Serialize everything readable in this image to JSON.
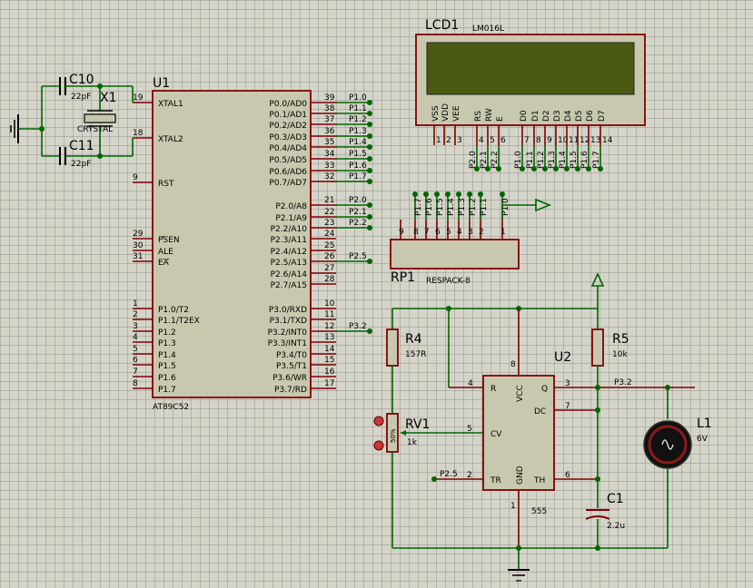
{
  "schematic": {
    "u1": {
      "ref": "U1",
      "part": "AT89C52",
      "left_pins": [
        {
          "num": "19",
          "name": "XTAL1"
        },
        {
          "num": "18",
          "name": "XTAL2"
        },
        {
          "num": "9",
          "name": "RST"
        },
        {
          "num": "29",
          "name": "PSEN"
        },
        {
          "num": "30",
          "name": "ALE"
        },
        {
          "num": "31",
          "name": "EA"
        },
        {
          "num": "1",
          "name": "P1.0/T2"
        },
        {
          "num": "2",
          "name": "P1.1/T2EX"
        },
        {
          "num": "3",
          "name": "P1.2"
        },
        {
          "num": "4",
          "name": "P1.3"
        },
        {
          "num": "5",
          "name": "P1.4"
        },
        {
          "num": "6",
          "name": "P1.5"
        },
        {
          "num": "7",
          "name": "P1.6"
        },
        {
          "num": "8",
          "name": "P1.7"
        }
      ],
      "right_pins": [
        {
          "num": "39",
          "name": "P0.0/AD0",
          "net": "P1.0"
        },
        {
          "num": "38",
          "name": "P0.1/AD1",
          "net": "P1.1"
        },
        {
          "num": "37",
          "name": "P0.2/AD2",
          "net": "P1.2"
        },
        {
          "num": "36",
          "name": "P0.3/AD3",
          "net": "P1.3"
        },
        {
          "num": "35",
          "name": "P0.4/AD4",
          "net": "P1.4"
        },
        {
          "num": "34",
          "name": "P0.5/AD5",
          "net": "P1.5"
        },
        {
          "num": "33",
          "name": "P0.6/AD6",
          "net": "P1.6"
        },
        {
          "num": "32",
          "name": "P0.7/AD7",
          "net": "P1.7"
        },
        {
          "num": "21",
          "name": "P2.0/A8",
          "net": "P2.0"
        },
        {
          "num": "22",
          "name": "P2.1/A9",
          "net": "P2.1"
        },
        {
          "num": "23",
          "name": "P2.2/A10",
          "net": "P2.2"
        },
        {
          "num": "24",
          "name": "P2.3/A11",
          "net": ""
        },
        {
          "num": "25",
          "name": "P2.4/A12",
          "net": ""
        },
        {
          "num": "26",
          "name": "P2.5/A13",
          "net": "P2.5"
        },
        {
          "num": "27",
          "name": "P2.6/A14",
          "net": ""
        },
        {
          "num": "28",
          "name": "P2.7/A15",
          "net": ""
        },
        {
          "num": "10",
          "name": "P3.0/RXD",
          "net": ""
        },
        {
          "num": "11",
          "name": "P3.1/TXD",
          "net": ""
        },
        {
          "num": "12",
          "name": "P3.2/INT0",
          "net": "P3.2"
        },
        {
          "num": "13",
          "name": "P3.3/INT1",
          "net": ""
        },
        {
          "num": "14",
          "name": "P3.4/T0",
          "net": ""
        },
        {
          "num": "15",
          "name": "P3.5/T1",
          "net": ""
        },
        {
          "num": "16",
          "name": "P3.6/WR",
          "net": ""
        },
        {
          "num": "17",
          "name": "P3.7/RD",
          "net": ""
        }
      ]
    },
    "lcd": {
      "ref": "LCD1",
      "part": "LM016L",
      "pins": [
        {
          "name": "VSS",
          "num": "1",
          "net": ""
        },
        {
          "name": "VDD",
          "num": "2",
          "net": ""
        },
        {
          "name": "VEE",
          "num": "3",
          "net": ""
        },
        {
          "name": "RS",
          "num": "4",
          "net": "P2.0"
        },
        {
          "name": "RW",
          "num": "5",
          "net": "P2.1"
        },
        {
          "name": "E",
          "num": "6",
          "net": "P2.2"
        },
        {
          "name": "D0",
          "num": "7",
          "net": "P1.0"
        },
        {
          "name": "D1",
          "num": "8",
          "net": "P1.1"
        },
        {
          "name": "D2",
          "num": "9",
          "net": "P1.2"
        },
        {
          "name": "D3",
          "num": "10",
          "net": "P1.3"
        },
        {
          "name": "D4",
          "num": "11",
          "net": "P1.4"
        },
        {
          "name": "D5",
          "num": "12",
          "net": "P1.5"
        },
        {
          "name": "D6",
          "num": "13",
          "net": "P1.6"
        },
        {
          "name": "D7",
          "num": "14",
          "net": "P1.7"
        }
      ]
    },
    "rp1": {
      "ref": "RP1",
      "part": "RESPACK-8",
      "pins": [
        {
          "num": "9",
          "net": ""
        },
        {
          "num": "8",
          "net": "P1.7"
        },
        {
          "num": "7",
          "net": "P1.6"
        },
        {
          "num": "6",
          "net": "P1.5"
        },
        {
          "num": "5",
          "net": "P1.4"
        },
        {
          "num": "4",
          "net": "P1.3"
        },
        {
          "num": "3",
          "net": "P1.2"
        },
        {
          "num": "2",
          "net": "P1.1"
        },
        {
          "num": "1",
          "net": "P1.0"
        }
      ]
    },
    "c10": {
      "ref": "C10",
      "value": "22pF"
    },
    "c11": {
      "ref": "C11",
      "value": "22pF"
    },
    "x1": {
      "ref": "X1",
      "value": "CRYSTAL"
    },
    "u2": {
      "ref": "U2",
      "part": "555",
      "pins": {
        "r": "R",
        "vcc": "VCC",
        "q": "Q",
        "dc": "DC",
        "cv": "CV",
        "tr": "TR",
        "gnd": "GND",
        "th": "TH"
      },
      "pin_nums": {
        "r": "4",
        "vcc": "8",
        "q": "3",
        "dc": "7",
        "cv": "5",
        "tr": "2",
        "gnd": "1",
        "th": "6"
      }
    },
    "r4": {
      "ref": "R4",
      "value": "157R"
    },
    "r5": {
      "ref": "R5",
      "value": "10k"
    },
    "rv1": {
      "ref": "RV1",
      "value": "1k",
      "wiper": "50%"
    },
    "c1": {
      "ref": "C1",
      "value": "2.2u"
    },
    "l1": {
      "ref": "L1",
      "value": "6V"
    },
    "nets": {
      "tr_net": "P2.5",
      "q_net": "P3.2"
    }
  },
  "colors": {
    "wire": "#006600",
    "pin": "#800000",
    "body": "#c8c8ae",
    "lcd_screen": "#4a5a10"
  }
}
